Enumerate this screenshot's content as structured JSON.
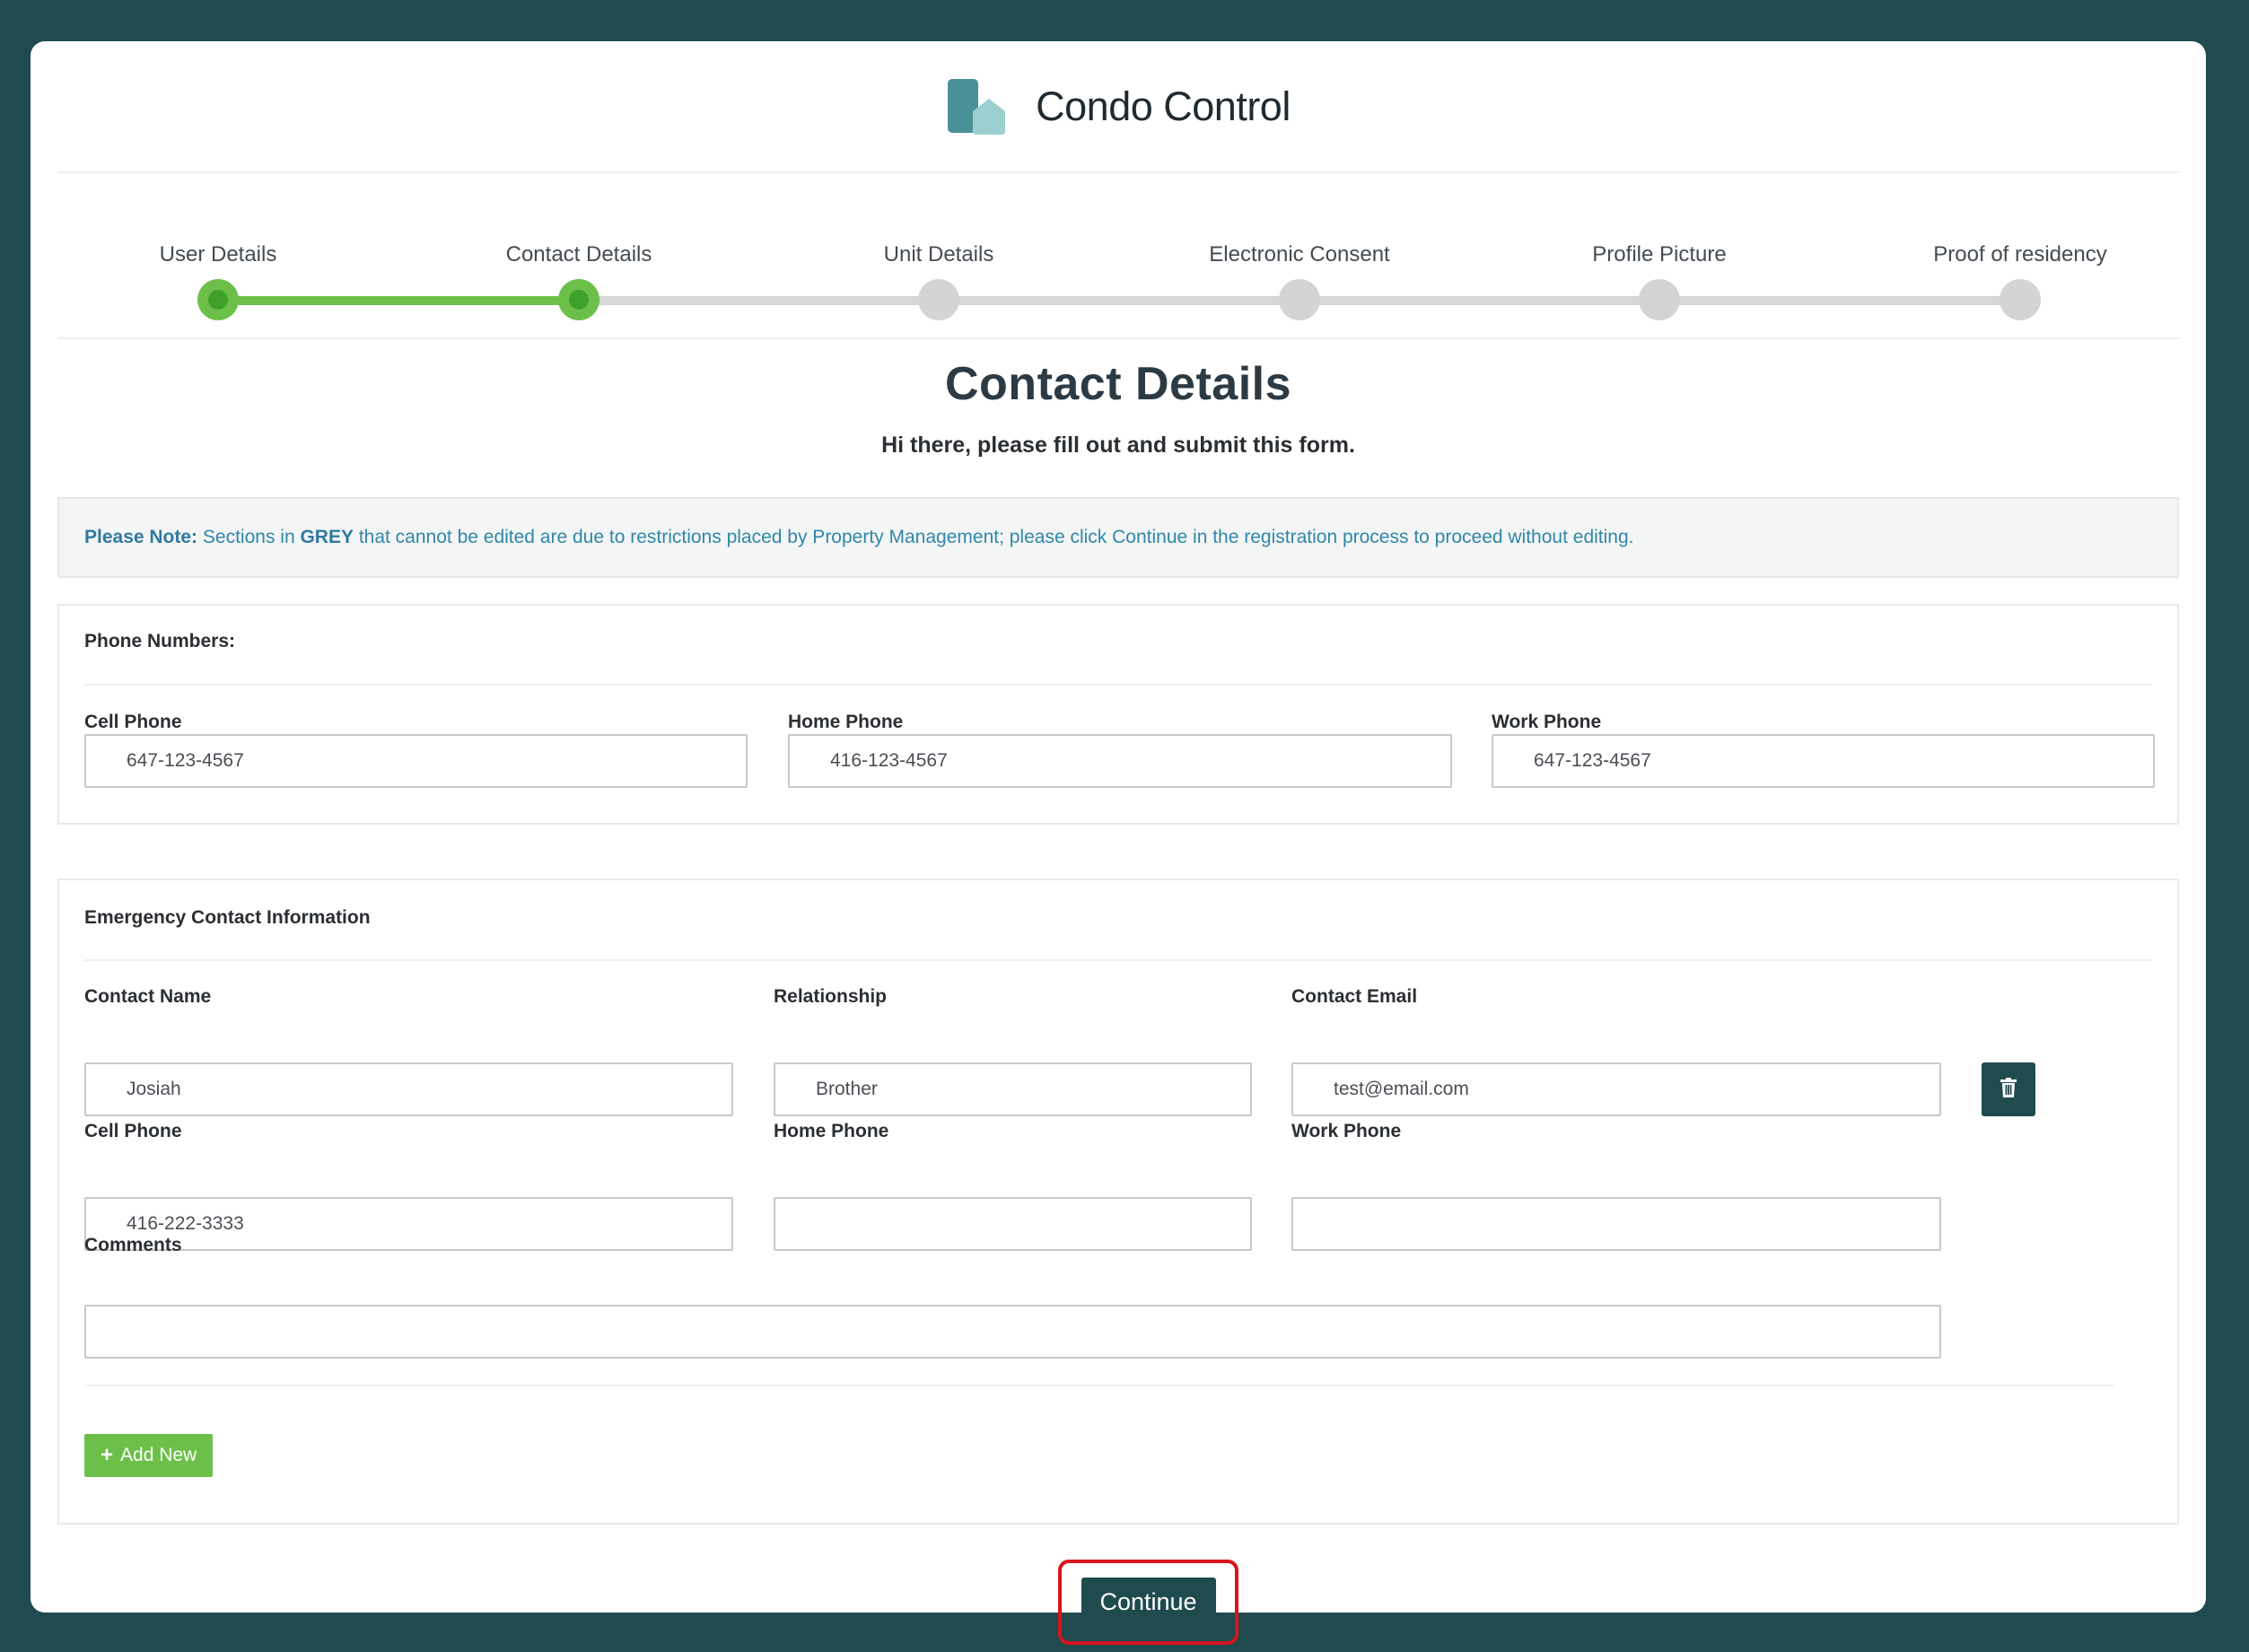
{
  "brand": {
    "name": "Condo Control"
  },
  "stepper": {
    "steps": [
      {
        "label": "User Details",
        "state": "done"
      },
      {
        "label": "Contact Details",
        "state": "current"
      },
      {
        "label": "Unit Details",
        "state": "pending"
      },
      {
        "label": "Electronic Consent",
        "state": "pending"
      },
      {
        "label": "Profile Picture",
        "state": "pending"
      },
      {
        "label": "Proof of residency",
        "state": "pending"
      }
    ]
  },
  "page": {
    "title": "Contact Details",
    "subtitle": "Hi there, please fill out and submit this form."
  },
  "note": {
    "prefix": "Please Note:",
    "text1": " Sections in ",
    "grey": "GREY",
    "text2": " that cannot be edited are due to restrictions placed by Property Management; please click Continue in the registration process to proceed without editing."
  },
  "phone_numbers": {
    "title": "Phone Numbers:",
    "cell_label": "Cell Phone",
    "cell_value": "647-123-4567",
    "home_label": "Home Phone",
    "home_value": "416-123-4567",
    "work_label": "Work Phone",
    "work_value": "647-123-4567"
  },
  "emergency": {
    "title": "Emergency Contact Information",
    "name_label": "Contact Name",
    "name_value": "Josiah",
    "relationship_label": "Relationship",
    "relationship_value": "Brother",
    "email_label": "Contact Email",
    "email_value": "test@email.com",
    "cell_label": "Cell Phone",
    "cell_value": "416-222-3333",
    "home_label": "Home Phone",
    "home_value": "",
    "work_label": "Work Phone",
    "work_value": "",
    "comments_label": "Comments",
    "comments_value": "",
    "add_new_label": "Add New",
    "delete_icon": "trash-icon"
  },
  "actions": {
    "continue_label": "Continue"
  },
  "colors": {
    "background": "#1f4b4f",
    "accent_green": "#6cc04a",
    "primary_button": "#1f4b4f",
    "highlight_border": "#d8141d"
  }
}
